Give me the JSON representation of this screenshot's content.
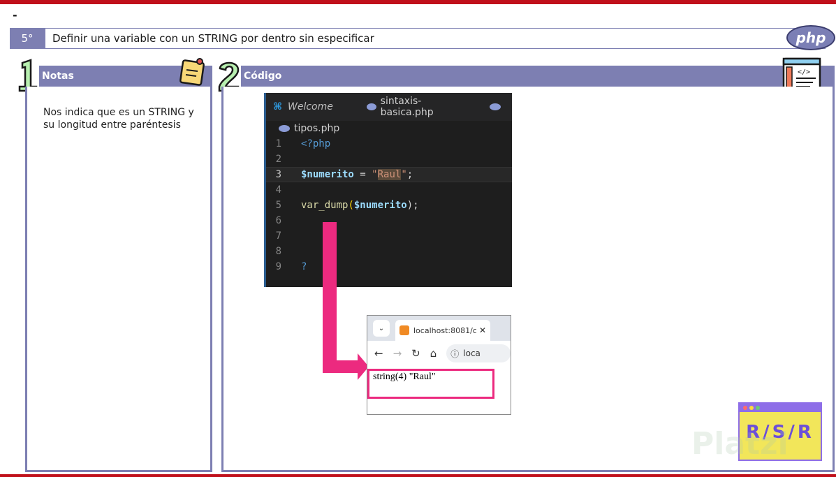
{
  "slide": {
    "dash": "-",
    "step_number": "5°",
    "title": "Definir una variable con un STRING por dentro sin especificar",
    "php_logo": "php"
  },
  "notes": {
    "number": "1",
    "heading": "Notas",
    "text": "Nos indica que es un STRING y su longitud entre paréntesis"
  },
  "code": {
    "number": "2",
    "heading": "Código",
    "editor": {
      "tabs": [
        "Welcome",
        "sintaxis-basica.php"
      ],
      "breadcrumb": "tipos.php",
      "lines": [
        {
          "n": "1",
          "text": "<?php"
        },
        {
          "n": "2",
          "text": ""
        },
        {
          "n": "3",
          "var": "$numerito",
          "op": " = ",
          "q1": "\"",
          "str": "Raul",
          "q2": "\"",
          "end": ";"
        },
        {
          "n": "4",
          "text": ""
        },
        {
          "n": "5",
          "fn": "var_dump",
          "open": "(",
          "var": "$numerito",
          "close": ");"
        },
        {
          "n": "6",
          "text": ""
        },
        {
          "n": "7",
          "text": ""
        },
        {
          "n": "8",
          "text": ""
        },
        {
          "n": "9",
          "text": "?"
        }
      ]
    },
    "browser": {
      "tab_title": "localhost:8081/c",
      "address_partial": "loca",
      "output": "string(4) \"Raul\""
    }
  },
  "colors": {
    "accent": "#7d7fb2",
    "highlight": "#ec2a7f",
    "top_bar": "#c0101a"
  },
  "logo": {
    "text": "R/S/R"
  },
  "watermark": "Platzi"
}
